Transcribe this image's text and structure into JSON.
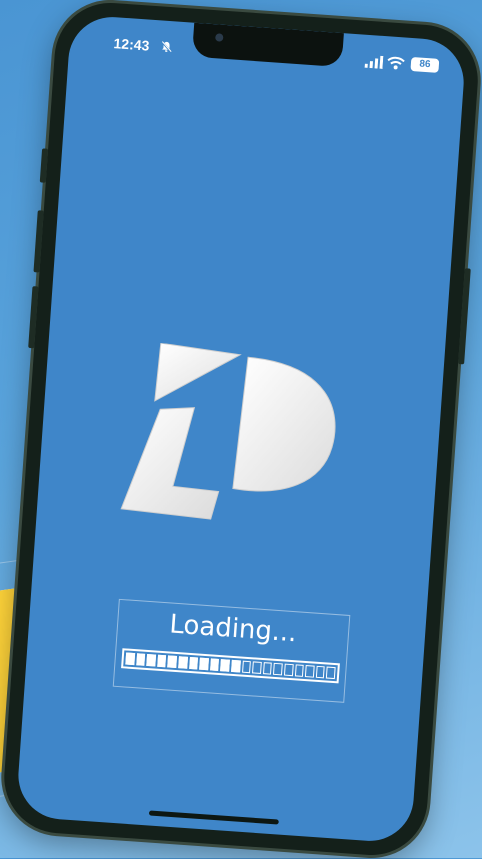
{
  "status_bar": {
    "time": "12:43",
    "battery": "86",
    "icons": [
      "bell-muted-icon",
      "signal-icon",
      "wifi-icon",
      "battery-icon"
    ]
  },
  "splash": {
    "logo": "LP-logo",
    "loading_label": "Loading...",
    "progress": {
      "filled_segments": 11,
      "total_segments": 20
    }
  },
  "colors": {
    "screen_background": "#3f86c9",
    "page_background": "#5aa4dc",
    "accent_tile": "#ffd43a"
  }
}
